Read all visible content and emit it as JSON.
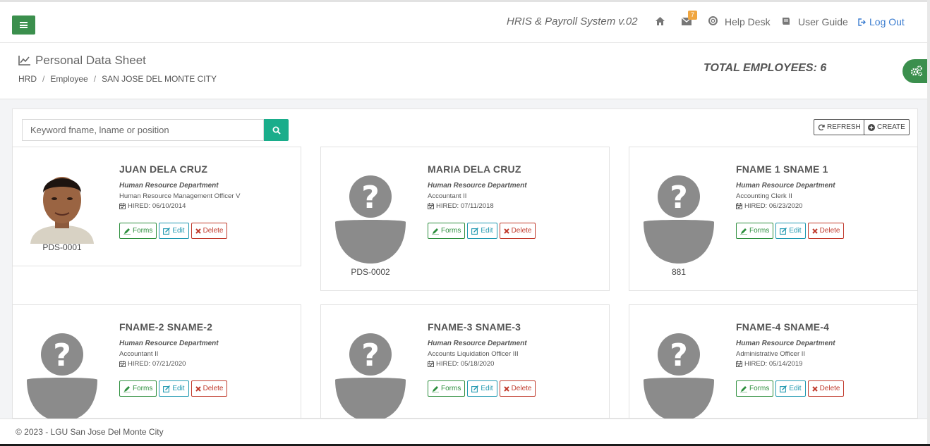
{
  "topbar": {
    "app_title": "HRIS & Payroll System v.02",
    "mail_count": "7",
    "help_desk": "Help Desk",
    "user_guide": "User Guide",
    "logout": "Log Out",
    "accent": "#3b8f4d",
    "link_color": "#3c7dd0"
  },
  "page": {
    "title": "Personal Data Sheet",
    "breadcrumb": [
      "HRD",
      "Employee",
      "SAN JOSE DEL MONTE CITY"
    ],
    "total_employees": "TOTAL EMPLOYEES: 6"
  },
  "toolbar": {
    "search_placeholder": "Keyword fname, lname or position",
    "refresh_label": "REFRESH",
    "create_label": "CREATE"
  },
  "actions": {
    "forms": "Forms",
    "edit": "Edit",
    "delete": "Delete"
  },
  "employees": [
    {
      "name": "JUAN DELA CRUZ",
      "department": "Human Resource Department",
      "position": "Human Resource Management Officer V",
      "hired": "HIRED: 06/10/2014",
      "code": "PDS-0001",
      "photo": "person-photo"
    },
    {
      "name": "MARIA DELA CRUZ",
      "department": "Human Resource Department",
      "position": "Accountant II",
      "hired": "HIRED: 07/11/2018",
      "code": "PDS-0002",
      "photo": "placeholder-avatar"
    },
    {
      "name": "FNAME 1 SNAME 1",
      "department": "Human Resource Department",
      "position": "Accounting Clerk II",
      "hired": "HIRED: 06/23/2020",
      "code": "881",
      "photo": "placeholder-avatar"
    },
    {
      "name": "FNAME-2 SNAME-2",
      "department": "Human Resource Department",
      "position": "Accountant II",
      "hired": "HIRED: 07/21/2020",
      "code": "",
      "photo": "placeholder-avatar"
    },
    {
      "name": "FNAME-3 SNAME-3",
      "department": "Human Resource Department",
      "position": "Accounts Liquidation Officer III",
      "hired": "HIRED: 05/18/2020",
      "code": "",
      "photo": "placeholder-avatar"
    },
    {
      "name": "FNAME-4 SNAME-4",
      "department": "Human Resource Department",
      "position": "Administrative Officer II",
      "hired": "HIRED: 05/14/2019",
      "code": "",
      "photo": "placeholder-avatar"
    }
  ],
  "footer": {
    "text": "© 2023 - LGU San Jose Del Monte City"
  }
}
